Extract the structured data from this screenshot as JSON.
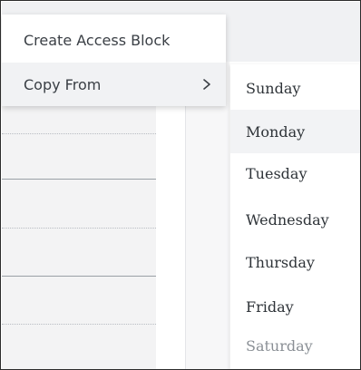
{
  "context_menu": {
    "items": [
      {
        "label": "Create Access Block"
      },
      {
        "label": "Copy From",
        "icon": "chevron-right-icon"
      }
    ]
  },
  "submenu": {
    "days": [
      "Sunday",
      "Monday",
      "Tuesday",
      "Wednesday",
      "Thursday",
      "Friday",
      "Saturday"
    ],
    "highlighted": "Monday"
  },
  "colors": {
    "menu_bg": "#ffffff",
    "hover_bg": "#f1f2f4",
    "text": "#3a3f45",
    "muted_text": "#8a8f95"
  }
}
